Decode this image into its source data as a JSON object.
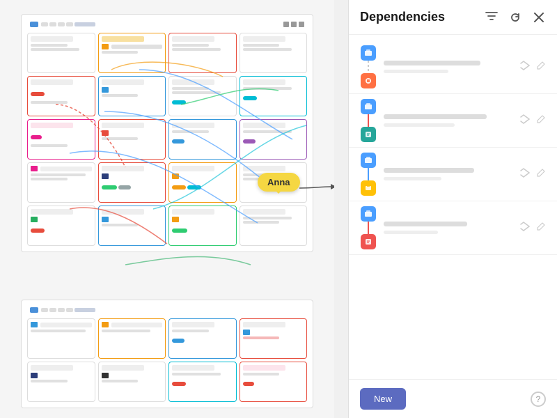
{
  "panel": {
    "title": "Dependencies",
    "filter_icon": "▽",
    "refresh_icon": "↺",
    "close_icon": "✕",
    "new_button_label": "New",
    "help_icon_label": "?"
  },
  "anna_label": "Anna",
  "dependency_groups": [
    {
      "id": "group1",
      "top_icon_color": "blue",
      "line_color": "dashed-gray",
      "bottom_icon_color": "orange",
      "line_type": "dashed"
    },
    {
      "id": "group2",
      "top_icon_color": "blue",
      "line_color": "red",
      "bottom_icon_color": "teal",
      "line_type": "solid-red"
    },
    {
      "id": "group3",
      "top_icon_color": "blue",
      "line_color": "blue",
      "bottom_icon_color": "yellow",
      "line_type": "solid-blue"
    },
    {
      "id": "group4",
      "top_icon_color": "blue",
      "line_color": "red",
      "bottom_icon_color": "red",
      "line_type": "solid-red"
    }
  ]
}
